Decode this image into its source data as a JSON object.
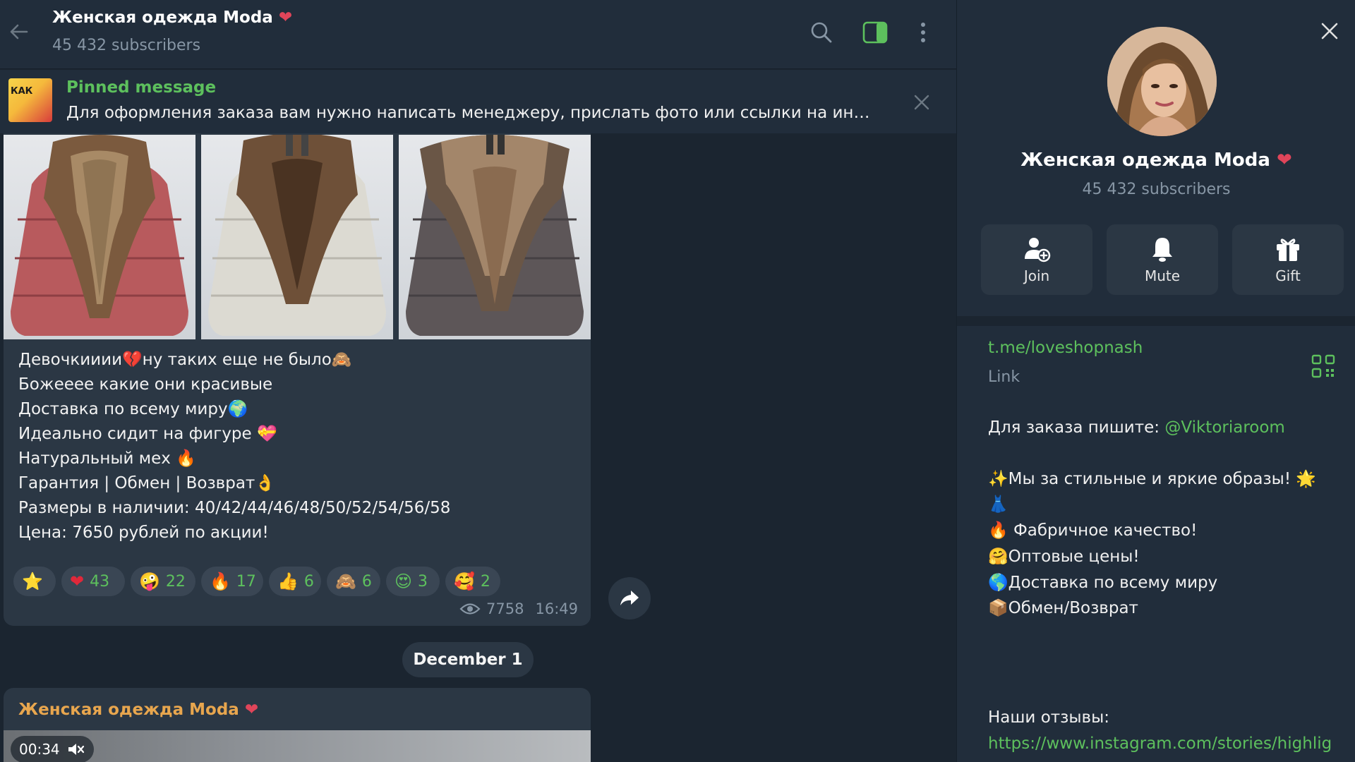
{
  "header": {
    "title": "Женская одежда Moda",
    "title_emoji": "❤",
    "subscribers": "45 432 subscribers"
  },
  "pinned": {
    "title": "Pinned message",
    "text": "Для оформления заказа вам нужно написать менеджеру, прислать фото или ссылки на инте...",
    "thumb_text": "КАК"
  },
  "message": {
    "lines": [
      {
        "text": "Девочкииии",
        "emoji": "💔",
        "after": "ну таких еще не было",
        "emoji2": "🙈"
      },
      {
        "text": "Божеееe какие они красивые"
      },
      {
        "text": "Доставка по всему миру",
        "emoji": "🌍"
      },
      {
        "text": "Идеально сидит на фигуре ",
        "emoji": "💝"
      },
      {
        "text": "Натуральный мех ",
        "emoji": "🔥"
      },
      {
        "text": "Гарантия | Обмен | Возврат",
        "emoji": "👌"
      },
      {
        "text": "Размеры в наличии: 40/42/44/46/48/50/52/54/56/58"
      },
      {
        "text": "Цена: 7650 рублей по акции!"
      }
    ],
    "reactions": [
      {
        "emoji": "⭐",
        "count": ""
      },
      {
        "emoji": "❤",
        "count": "43"
      },
      {
        "emoji": "🤪",
        "count": "22"
      },
      {
        "emoji": "🔥",
        "count": "17"
      },
      {
        "emoji": "👍",
        "count": "6"
      },
      {
        "emoji": "🙈",
        "count": "6"
      },
      {
        "emoji": "😍",
        "count": "3"
      },
      {
        "emoji": "🥰",
        "count": "2"
      }
    ],
    "views": "7758",
    "time": "16:49"
  },
  "date_separator": "December 1",
  "message2": {
    "author": "Женская одежда Moda",
    "author_emoji": "❤",
    "video_duration": "00:34"
  },
  "side": {
    "title": "Женская одежда Moda",
    "title_emoji": "❤",
    "subscribers": "45 432 subscribers",
    "actions": [
      {
        "label": "Join",
        "icon": "add-user-icon"
      },
      {
        "label": "Mute",
        "icon": "bell-icon"
      },
      {
        "label": "Gift",
        "icon": "gift-icon"
      }
    ],
    "link_url": "t.me/loveshopnash",
    "link_label": "Link",
    "order_prefix": "Для заказа пишите: ",
    "order_handle": "@Viktoriaroom",
    "desc_lines": [
      {
        "emoji": "✨",
        "text": "Мы за стильные и яркие образы! ",
        "emoji2": "🌟"
      },
      {
        "emoji": "👗",
        "text": ""
      },
      {
        "emoji": "🔥",
        "text": " Фабричное качество!"
      },
      {
        "emoji": "🤗",
        "text": "Оптовые цены!"
      },
      {
        "emoji": "🌎",
        "text": "Доставка по всему миру"
      },
      {
        "emoji": "📦",
        "text": "Обмен/Возврат"
      }
    ],
    "reviews_label": "Наши отзывы:",
    "reviews_url": "https://www.instagram.com/stories/highlig"
  },
  "colors": {
    "accent_green": "#5dc05d",
    "author_orange": "#e8a64e",
    "bg_chat": "#1b2530",
    "bg_panel": "#212d3b",
    "bubble": "#2b3744"
  }
}
